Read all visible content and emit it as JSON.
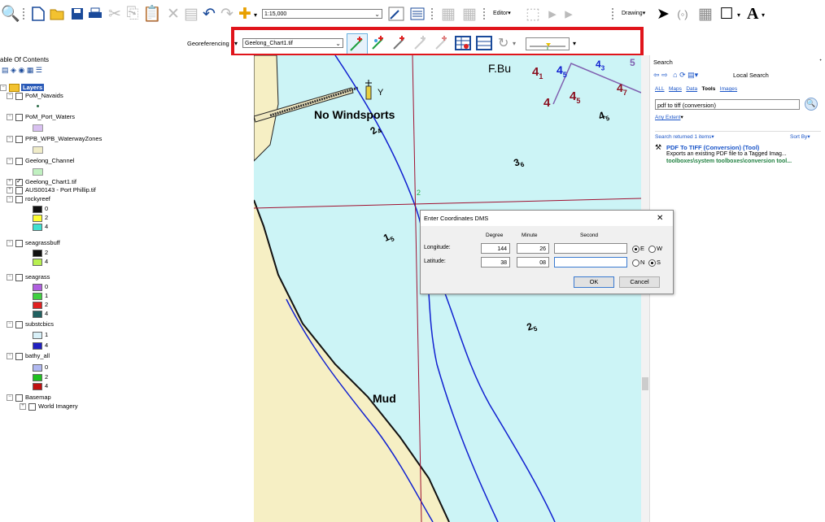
{
  "toolbar": {
    "scale_value": "1:15,000",
    "editor_label": "Editor",
    "drawing_label": "Drawing",
    "text_tool": "A"
  },
  "georef": {
    "label": "Georeferencing",
    "layer_value": "Geelong_Chart1.tif"
  },
  "toc": {
    "title": "able Of Contents",
    "root": "Layers",
    "items": [
      {
        "label": "PoM_Navaids"
      },
      {
        "label": "PoM_Port_Waters"
      },
      {
        "label": "PPB_WPB_WaterwayZones"
      },
      {
        "label": "Geelong_Channel"
      },
      {
        "label": "Geelong_Chart1.tif"
      },
      {
        "label": "AUS00143 - Port Phillip.tif"
      },
      {
        "label": "rockyreef"
      },
      {
        "label": "seagrassbuff"
      },
      {
        "label": "seagrass"
      },
      {
        "label": "substcbics"
      },
      {
        "label": "bathy_all"
      },
      {
        "label": "Basemap"
      },
      {
        "label": "World Imagery"
      }
    ],
    "legend": {
      "rockyreef": [
        "0",
        "2",
        "4"
      ],
      "seagrassbuff": [
        "2",
        "4"
      ],
      "seagrass": [
        "0",
        "1",
        "2",
        "4"
      ],
      "substcbics": [
        "1",
        "4"
      ],
      "bathy_all": [
        "0",
        "2",
        "4"
      ]
    },
    "colors": {
      "navaid": "#2e6e4a",
      "port_waters": "#d8c0f0",
      "waterway": "#f0ecc8",
      "channel": "#c0f0c0",
      "r0": "#111111",
      "r2": "#ffff33",
      "r4": "#40e0d0",
      "sb2": "#111111",
      "sb4": "#b8f050",
      "sg0": "#b060e0",
      "sg1": "#40d040",
      "sg2": "#e02020",
      "sg4": "#206060",
      "sc1": "#d8f0f8",
      "sc4": "#2020c0",
      "b0": "#b0b8f0",
      "b2": "#20c020",
      "b4": "#c01010"
    }
  },
  "map": {
    "labels": {
      "fbu": "F.Bu",
      "no_windsports": "No Windsports",
      "y": "Y",
      "mud": "Mud",
      "d41": "4",
      "d41s": "1",
      "d45": "4",
      "d45s": "5",
      "d43": "4",
      "d43s": "3",
      "d4": "4",
      "d47": "4",
      "d47s": "7",
      "d24": "2",
      "d24s": "4",
      "d36": "3",
      "d36s": "6",
      "d15": "1",
      "d15s": "5",
      "d25": "2",
      "d25s": "5",
      "d4b": "4",
      "d4bs": "5",
      "d5": "5",
      "pt2": "2"
    }
  },
  "search": {
    "title": "Search",
    "location": "Local Search",
    "tabs": [
      "ALL",
      "Maps",
      "Data",
      "Tools",
      "Images"
    ],
    "query": "pdf to tiff (conversion)",
    "extent": "Any Extent",
    "results_count": "Search returned 1 items",
    "sort": "Sort By",
    "result_title": "PDF To TIFF (Conversion) (Tool)",
    "result_desc": "Exports an existing PDF file to a Tagged Imag...",
    "result_path": "toolboxes\\system toolboxes\\conversion tool..."
  },
  "dialog": {
    "title": "Enter Coordinates DMS",
    "col_degree": "Degree",
    "col_minute": "Minute",
    "col_second": "Second",
    "lon_label": "Longitude:",
    "lat_label": "Latitude:",
    "lon_deg": "144",
    "lon_min": "26",
    "lon_sec": "",
    "lat_deg": "38",
    "lat_min": "08",
    "lat_sec": "",
    "e": "E",
    "w": "W",
    "n": "N",
    "s": "S",
    "ok": "OK",
    "cancel": "Cancel"
  }
}
